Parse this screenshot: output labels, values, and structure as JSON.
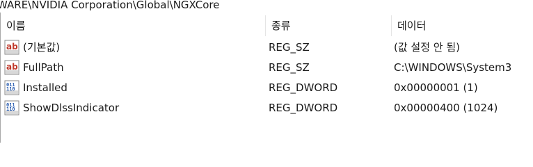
{
  "address_path": "WARE\\NVIDIA Corporation\\Global\\NGXCore",
  "columns": {
    "name": "이름",
    "type": "종류",
    "data": "데이터"
  },
  "rows": [
    {
      "icon": "string-value-icon",
      "name": "(기본값)",
      "type": "REG_SZ",
      "data": "(값 설정 안 됨)"
    },
    {
      "icon": "string-value-icon",
      "name": "FullPath",
      "type": "REG_SZ",
      "data": "C:\\WINDOWS\\System3"
    },
    {
      "icon": "dword-value-icon",
      "name": "Installed",
      "type": "REG_DWORD",
      "data": "0x00000001 (1)"
    },
    {
      "icon": "dword-value-icon",
      "name": "ShowDlssIndicator",
      "type": "REG_DWORD",
      "data": "0x00000400 (1024)"
    }
  ],
  "colors": {
    "string_icon_red": "#c0392b",
    "dword_icon_blue": "#2a5db0"
  }
}
